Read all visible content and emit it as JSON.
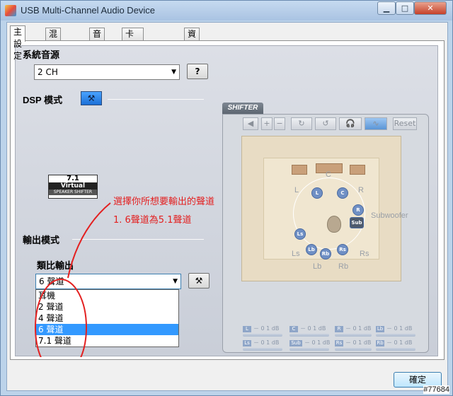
{
  "window": {
    "title": "USB Multi-Channel Audio Device",
    "controls": {
      "minimize": "▁",
      "maximize": "□",
      "close": "✕"
    }
  },
  "tabs": [
    {
      "label": "主設定",
      "active": true
    },
    {
      "label": "混音音量"
    },
    {
      "label": "音效"
    },
    {
      "label": "卡拉OK/魔音器"
    },
    {
      "label": "資訊"
    }
  ],
  "system_source": {
    "label": "系統音源",
    "selected": "2 CH",
    "help_button": "?"
  },
  "dsp": {
    "label": "DSP 模式",
    "logo": {
      "line1": "7.1",
      "line2": "Virtual",
      "line3": "SPEAKER SHIFTER"
    }
  },
  "annotation": {
    "line1": "選擇你所想要輸出的聲道",
    "line2": "1. 6聲道為5.1聲道"
  },
  "output_mode": {
    "label": "輸出模式",
    "analog_label": "類比輸出",
    "selected": "6 聲道",
    "options": [
      "耳機",
      "2 聲道",
      "4 聲道",
      "6 聲道",
      "7.1 聲道"
    ],
    "highlighted_index": 3
  },
  "shifter": {
    "tab_label": "SHIFTER",
    "toolbar": {
      "reset": "Reset"
    },
    "speakers": {
      "c": "C",
      "l": "L",
      "r": "R",
      "ls": "Ls",
      "rs": "Rs",
      "lb": "Lb",
      "rb": "Rb",
      "subwoofer": "Subwoofer",
      "sub": "Sub"
    },
    "levels": [
      {
        "chip": "L",
        "value": "－ 0 1 dB"
      },
      {
        "chip": "C",
        "value": "－ 0 1 dB"
      },
      {
        "chip": "R",
        "value": "－ 0 1 dB"
      },
      {
        "chip": "Lb",
        "value": "－ 0 1 dB"
      },
      {
        "chip": "Ls",
        "value": "－ 0 1 dB"
      },
      {
        "chip": "Sub",
        "value": "－ 0 1 dB"
      },
      {
        "chip": "Rs",
        "value": "－ 0 1 dB"
      },
      {
        "chip": "Rb",
        "value": "－ 0 1 dB"
      }
    ]
  },
  "footer": {
    "ok_label": "確定"
  },
  "watermark": "#77684",
  "colors": {
    "selection": "#3399ff",
    "annotation": "#e32020",
    "dsp_button": "#1b6fd6"
  }
}
